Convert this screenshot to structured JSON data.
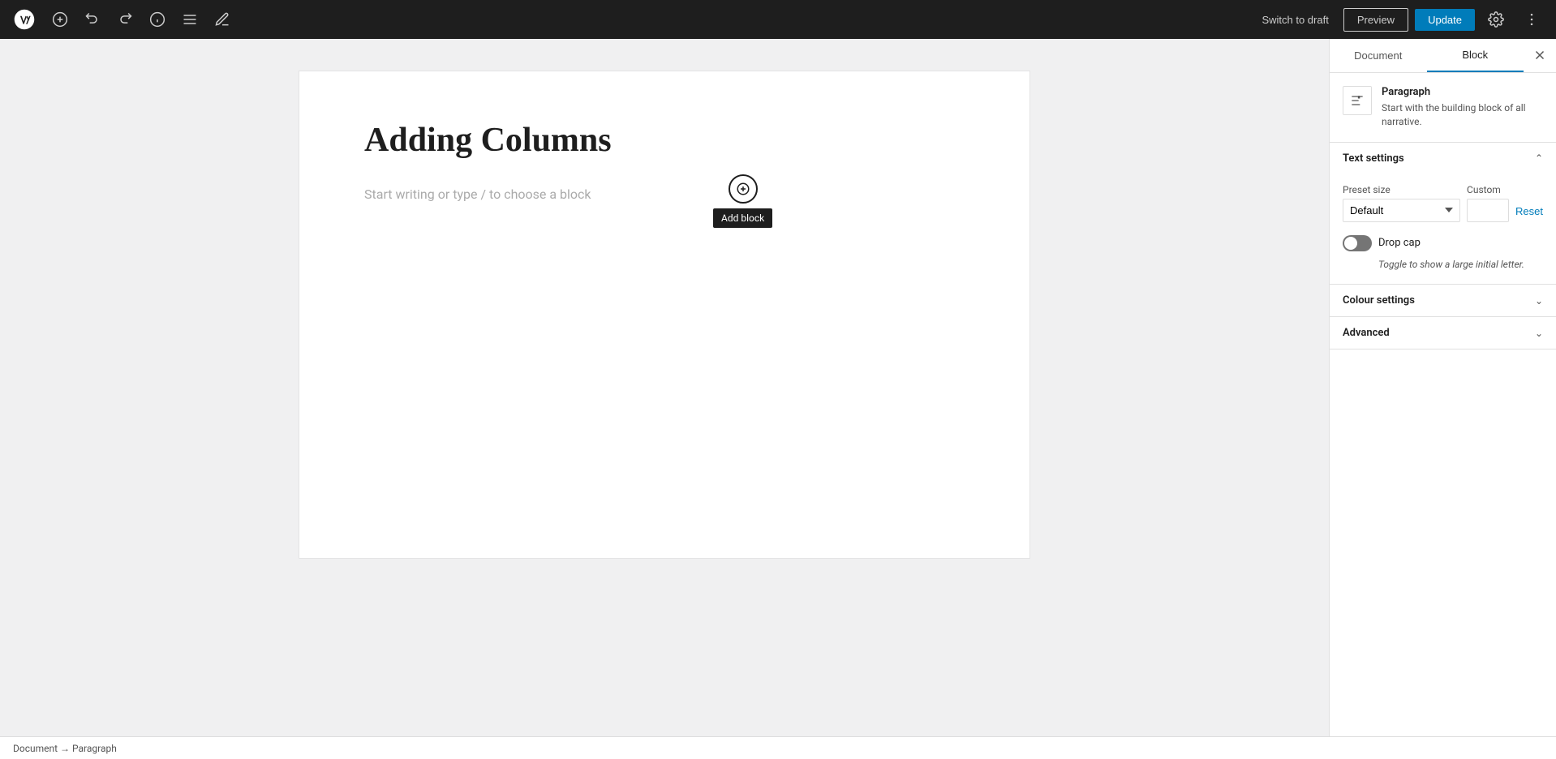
{
  "toolbar": {
    "add_label": "+",
    "undo_label": "↩",
    "redo_label": "↪",
    "info_label": "ℹ",
    "list_view_label": "☰",
    "tools_label": "✏",
    "switch_draft": "Switch to draft",
    "preview": "Preview",
    "update": "Update"
  },
  "editor": {
    "post_title": "Adding Columns",
    "placeholder": "Start writing or type / to choose a block",
    "add_block_tooltip": "Add block"
  },
  "status_bar": {
    "text": "Document → Paragraph"
  },
  "sidebar": {
    "tab_document": "Document",
    "tab_block": "Block",
    "active_tab": "Block",
    "block_name": "Paragraph",
    "block_description": "Start with the building block of all narrative.",
    "text_settings": {
      "title": "Text settings",
      "preset_size_label": "Preset size",
      "custom_label": "Custom",
      "preset_default": "Default",
      "reset_label": "Reset",
      "drop_cap_label": "Drop cap",
      "drop_cap_desc": "Toggle to show a large initial letter.",
      "drop_cap_on": false
    },
    "colour_settings": {
      "title": "Colour settings"
    },
    "advanced": {
      "title": "Advanced"
    }
  }
}
